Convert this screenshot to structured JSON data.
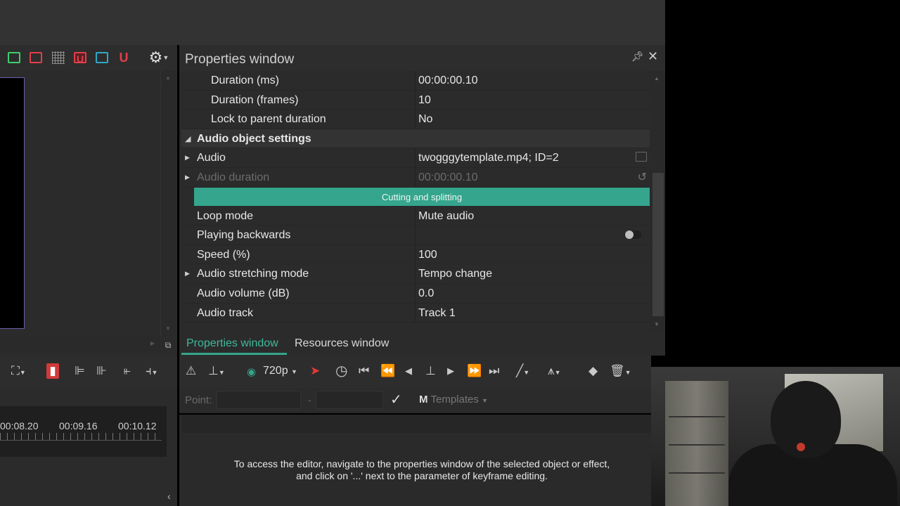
{
  "properties_window": {
    "title": "Properties window",
    "rows": [
      {
        "label": "Duration (ms)",
        "value": "00:00:00.10"
      },
      {
        "label": "Duration (frames)",
        "value": "10"
      },
      {
        "label": "Lock to parent duration",
        "value": "No"
      },
      {
        "label": "Audio object settings",
        "value": ""
      },
      {
        "label": "Audio",
        "value": "twogggytemplate.mp4; ID=2"
      },
      {
        "label": "Audio duration",
        "value": "00:00:00.10"
      },
      {
        "label": "Cutting and splitting",
        "value": ""
      },
      {
        "label": "Loop mode",
        "value": "Mute audio"
      },
      {
        "label": "Playing backwards",
        "value": ""
      },
      {
        "label": "Speed (%)",
        "value": "100"
      },
      {
        "label": "Audio stretching mode",
        "value": "Tempo change"
      },
      {
        "label": "Audio volume (dB)",
        "value": "0.0"
      },
      {
        "label": "Audio track",
        "value": "Track 1"
      }
    ],
    "playing_backwards_on": false
  },
  "tabs": {
    "properties": "Properties window",
    "resources": "Resources window"
  },
  "toolbar": {
    "resolution": "720p"
  },
  "keyframe": {
    "point_label": "Point:",
    "dash": "-",
    "templates_label": "Templates"
  },
  "timeline": {
    "ticks": [
      "00:08.20",
      "00:09.16",
      "00:10.12"
    ]
  },
  "editor": {
    "message_line1": "To access the editor, navigate to the properties window of the selected object or effect,",
    "message_line2": "and click on '...' next to the parameter of keyframe editing."
  },
  "colors": {
    "accent": "#35a58d",
    "background": "#2b2b2b"
  }
}
